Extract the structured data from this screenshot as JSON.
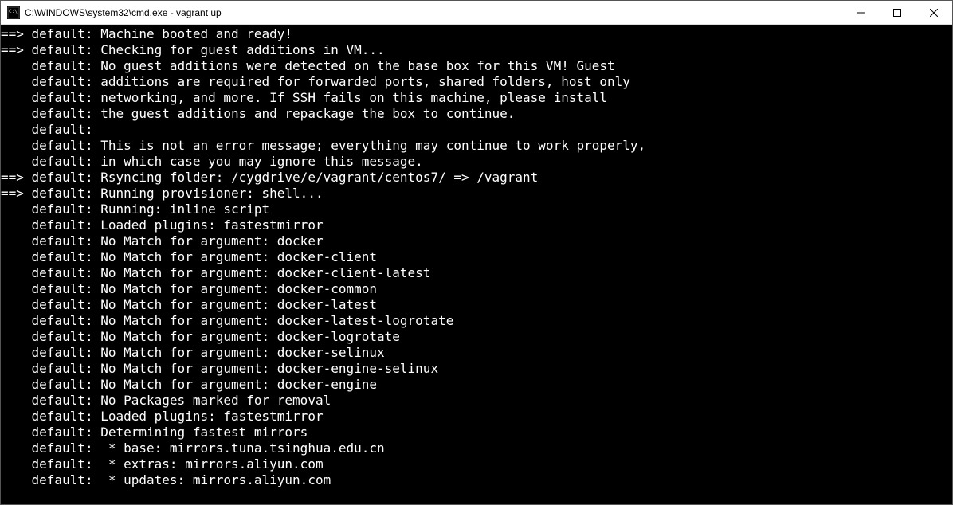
{
  "window": {
    "title": "C:\\WINDOWS\\system32\\cmd.exe - vagrant  up"
  },
  "terminal": {
    "lines": [
      {
        "arrow": "==>",
        "prefix": "default:",
        "text": " Machine booted and ready!"
      },
      {
        "arrow": "==>",
        "prefix": "default:",
        "text": " Checking for guest additions in VM..."
      },
      {
        "arrow": "",
        "prefix": "default:",
        "text": " No guest additions were detected on the base box for this VM! Guest"
      },
      {
        "arrow": "",
        "prefix": "default:",
        "text": " additions are required for forwarded ports, shared folders, host only"
      },
      {
        "arrow": "",
        "prefix": "default:",
        "text": " networking, and more. If SSH fails on this machine, please install"
      },
      {
        "arrow": "",
        "prefix": "default:",
        "text": " the guest additions and repackage the box to continue."
      },
      {
        "arrow": "",
        "prefix": "default:",
        "text": ""
      },
      {
        "arrow": "",
        "prefix": "default:",
        "text": " This is not an error message; everything may continue to work properly,"
      },
      {
        "arrow": "",
        "prefix": "default:",
        "text": " in which case you may ignore this message."
      },
      {
        "arrow": "==>",
        "prefix": "default:",
        "text": " Rsyncing folder: /cygdrive/e/vagrant/centos7/ => /vagrant"
      },
      {
        "arrow": "==>",
        "prefix": "default:",
        "text": " Running provisioner: shell..."
      },
      {
        "arrow": "",
        "prefix": "default:",
        "text": " Running: inline script"
      },
      {
        "arrow": "",
        "prefix": "default:",
        "text": " Loaded plugins: fastestmirror"
      },
      {
        "arrow": "",
        "prefix": "default:",
        "text": " No Match for argument: docker"
      },
      {
        "arrow": "",
        "prefix": "default:",
        "text": " No Match for argument: docker-client"
      },
      {
        "arrow": "",
        "prefix": "default:",
        "text": " No Match for argument: docker-client-latest"
      },
      {
        "arrow": "",
        "prefix": "default:",
        "text": " No Match for argument: docker-common"
      },
      {
        "arrow": "",
        "prefix": "default:",
        "text": " No Match for argument: docker-latest"
      },
      {
        "arrow": "",
        "prefix": "default:",
        "text": " No Match for argument: docker-latest-logrotate"
      },
      {
        "arrow": "",
        "prefix": "default:",
        "text": " No Match for argument: docker-logrotate"
      },
      {
        "arrow": "",
        "prefix": "default:",
        "text": " No Match for argument: docker-selinux"
      },
      {
        "arrow": "",
        "prefix": "default:",
        "text": " No Match for argument: docker-engine-selinux"
      },
      {
        "arrow": "",
        "prefix": "default:",
        "text": " No Match for argument: docker-engine"
      },
      {
        "arrow": "",
        "prefix": "default:",
        "text": " No Packages marked for removal"
      },
      {
        "arrow": "",
        "prefix": "default:",
        "text": " Loaded plugins: fastestmirror"
      },
      {
        "arrow": "",
        "prefix": "default:",
        "text": " Determining fastest mirrors"
      },
      {
        "arrow": "",
        "prefix": "default:",
        "text": "  * base: mirrors.tuna.tsinghua.edu.cn"
      },
      {
        "arrow": "",
        "prefix": "default:",
        "text": "  * extras: mirrors.aliyun.com"
      },
      {
        "arrow": "",
        "prefix": "default:",
        "text": "  * updates: mirrors.aliyun.com"
      }
    ]
  }
}
